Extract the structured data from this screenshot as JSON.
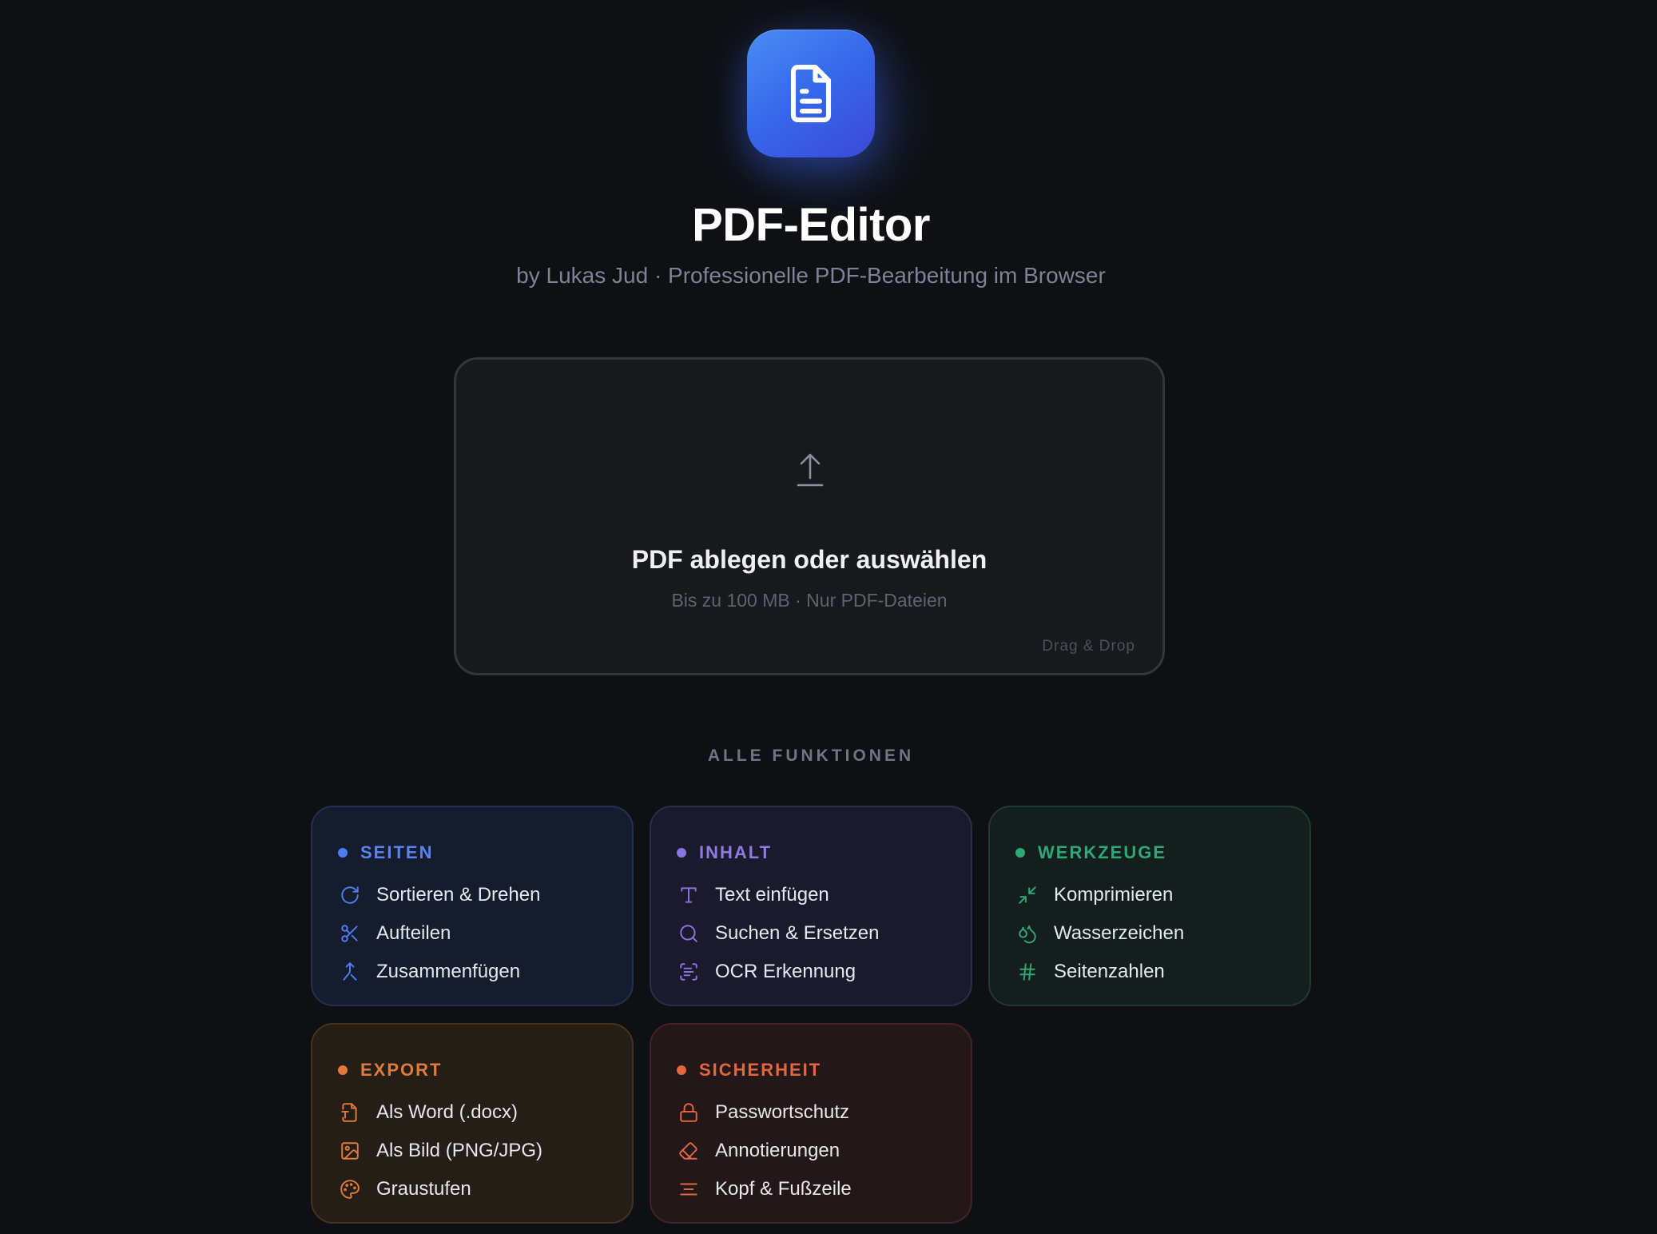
{
  "app": {
    "title": "PDF-Editor",
    "subtitle": "by Lukas Jud · Professionelle PDF-Bearbeitung im Browser",
    "logo_icon": "document-icon"
  },
  "dropzone": {
    "icon": "upload-icon",
    "title": "PDF ablegen oder auswählen",
    "subtitle": "Bis zu 100 MB · Nur PDF-Dateien",
    "hint": "Drag & Drop"
  },
  "features": {
    "section_title": "ALLE FUNKTIONEN",
    "groups": [
      {
        "title": "SEITEN",
        "color": "#4f7cf0",
        "items": [
          {
            "label": "Sortieren & Drehen",
            "icon": "rotate-icon"
          },
          {
            "label": "Aufteilen",
            "icon": "scissors-icon"
          },
          {
            "label": "Zusammenfügen",
            "icon": "merge-icon"
          }
        ]
      },
      {
        "title": "INHALT",
        "color": "#8b73e0",
        "items": [
          {
            "label": "Text einfügen",
            "icon": "text-icon"
          },
          {
            "label": "Suchen & Ersetzen",
            "icon": "search-icon"
          },
          {
            "label": "OCR Erkennung",
            "icon": "scan-text-icon"
          }
        ]
      },
      {
        "title": "WERKZEUGE",
        "color": "#2fa878",
        "items": [
          {
            "label": "Komprimieren",
            "icon": "compress-icon"
          },
          {
            "label": "Wasserzeichen",
            "icon": "droplets-icon"
          },
          {
            "label": "Seitenzahlen",
            "icon": "hash-icon"
          }
        ]
      },
      {
        "title": "EXPORT",
        "color": "#e07a3e",
        "items": [
          {
            "label": "Als Word (.docx)",
            "icon": "file-word-icon"
          },
          {
            "label": "Als Bild (PNG/JPG)",
            "icon": "image-icon"
          },
          {
            "label": "Graustufen",
            "icon": "palette-icon"
          }
        ]
      },
      {
        "title": "SICHERHEIT",
        "color": "#e2673f",
        "items": [
          {
            "label": "Passwortschutz",
            "icon": "lock-icon"
          },
          {
            "label": "Annotierungen",
            "icon": "eraser-icon"
          },
          {
            "label": "Kopf & Fußzeile",
            "icon": "align-center-icon"
          }
        ]
      }
    ]
  }
}
